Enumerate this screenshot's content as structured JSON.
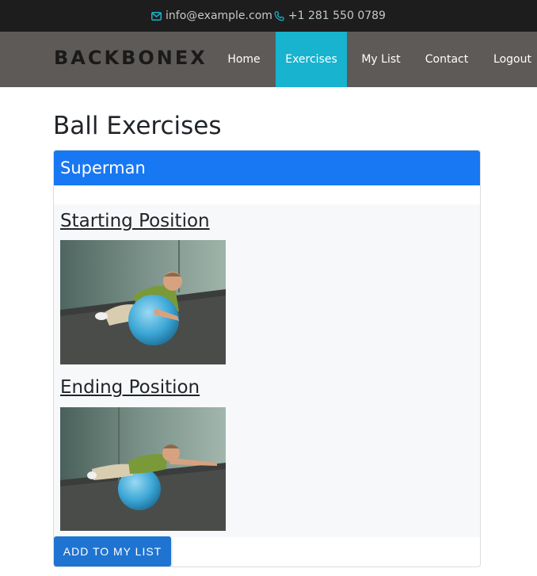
{
  "topbar": {
    "email": "info@example.com",
    "phone": "+1 281 550 0789"
  },
  "navbar": {
    "brand": "BACKBONEX",
    "items": [
      {
        "label": "Home"
      },
      {
        "label": "Exercises",
        "active": true
      },
      {
        "label": "My List"
      },
      {
        "label": "Contact"
      },
      {
        "label": "Logout"
      }
    ]
  },
  "page": {
    "title": "Ball Exercises"
  },
  "exercise": {
    "name": "Superman",
    "starting_heading": "Starting Position",
    "ending_heading": "Ending Position",
    "add_button_label": "ADD TO MY LIST"
  },
  "colors": {
    "accent_nav": "#17b3cf",
    "header_blue": "#1877f2",
    "button_blue": "#1f74d1"
  }
}
